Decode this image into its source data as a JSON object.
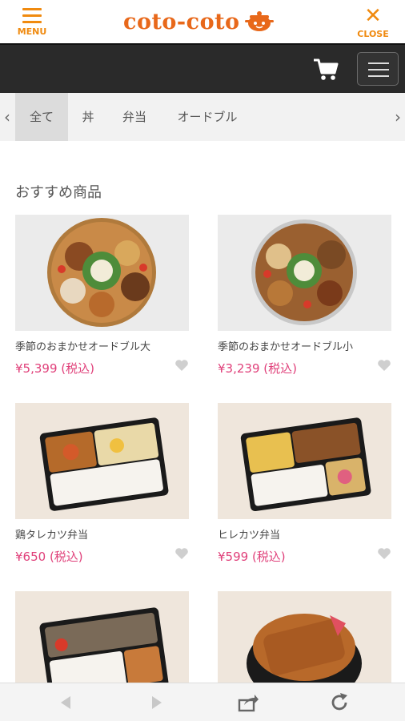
{
  "header": {
    "menu_label": "MENU",
    "logo_text": "coto-coto",
    "close_label": "CLOSE",
    "accent": "#f08a0f"
  },
  "tabs": [
    {
      "label": "全て",
      "active": true
    },
    {
      "label": "丼",
      "active": false
    },
    {
      "label": "弁当",
      "active": false
    },
    {
      "label": "オードブル",
      "active": false
    }
  ],
  "section_title": "おすすめ商品",
  "products": [
    {
      "name": "季節のおまかせオードブル大",
      "price": "¥5,399 (税込)"
    },
    {
      "name": "季節のおまかせオードブル小",
      "price": "¥3,239 (税込)"
    },
    {
      "name": "鶏タレカツ弁当",
      "price": "¥650 (税込)"
    },
    {
      "name": "ヒレカツ弁当",
      "price": "¥599 (税込)"
    },
    {
      "name": "",
      "price": ""
    },
    {
      "name": "",
      "price": ""
    }
  ],
  "icons": {
    "cart": "cart-icon",
    "nav": "hamburger-icon",
    "favorite": "heart-icon",
    "back": "back-arrow-icon",
    "forward": "forward-arrow-icon",
    "share": "share-icon",
    "reload": "reload-icon"
  },
  "colors": {
    "price": "#e0407a",
    "dark_bar": "#2a2a2a",
    "tabs_bg": "#f2f2f2"
  }
}
